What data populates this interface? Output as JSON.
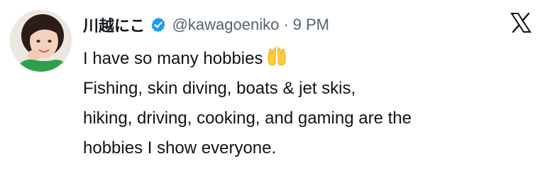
{
  "tweet": {
    "display_name": "川越にこ",
    "handle": "@kawagoeniko",
    "separator": "·",
    "time": "9 PM",
    "verified_icon": "verified-badge-icon",
    "platform_icon": "x-logo-icon",
    "lines": [
      "I have so many hobbies",
      "Fishing, skin diving, boats & jet skis,",
      "hiking, driving, cooking, and gaming are the",
      "hobbies I show everyone."
    ],
    "emoji": "raising-hands-emoji"
  },
  "colors": {
    "name": "#0f1419",
    "secondary": "#536471",
    "verified": "#1d9bf0"
  }
}
